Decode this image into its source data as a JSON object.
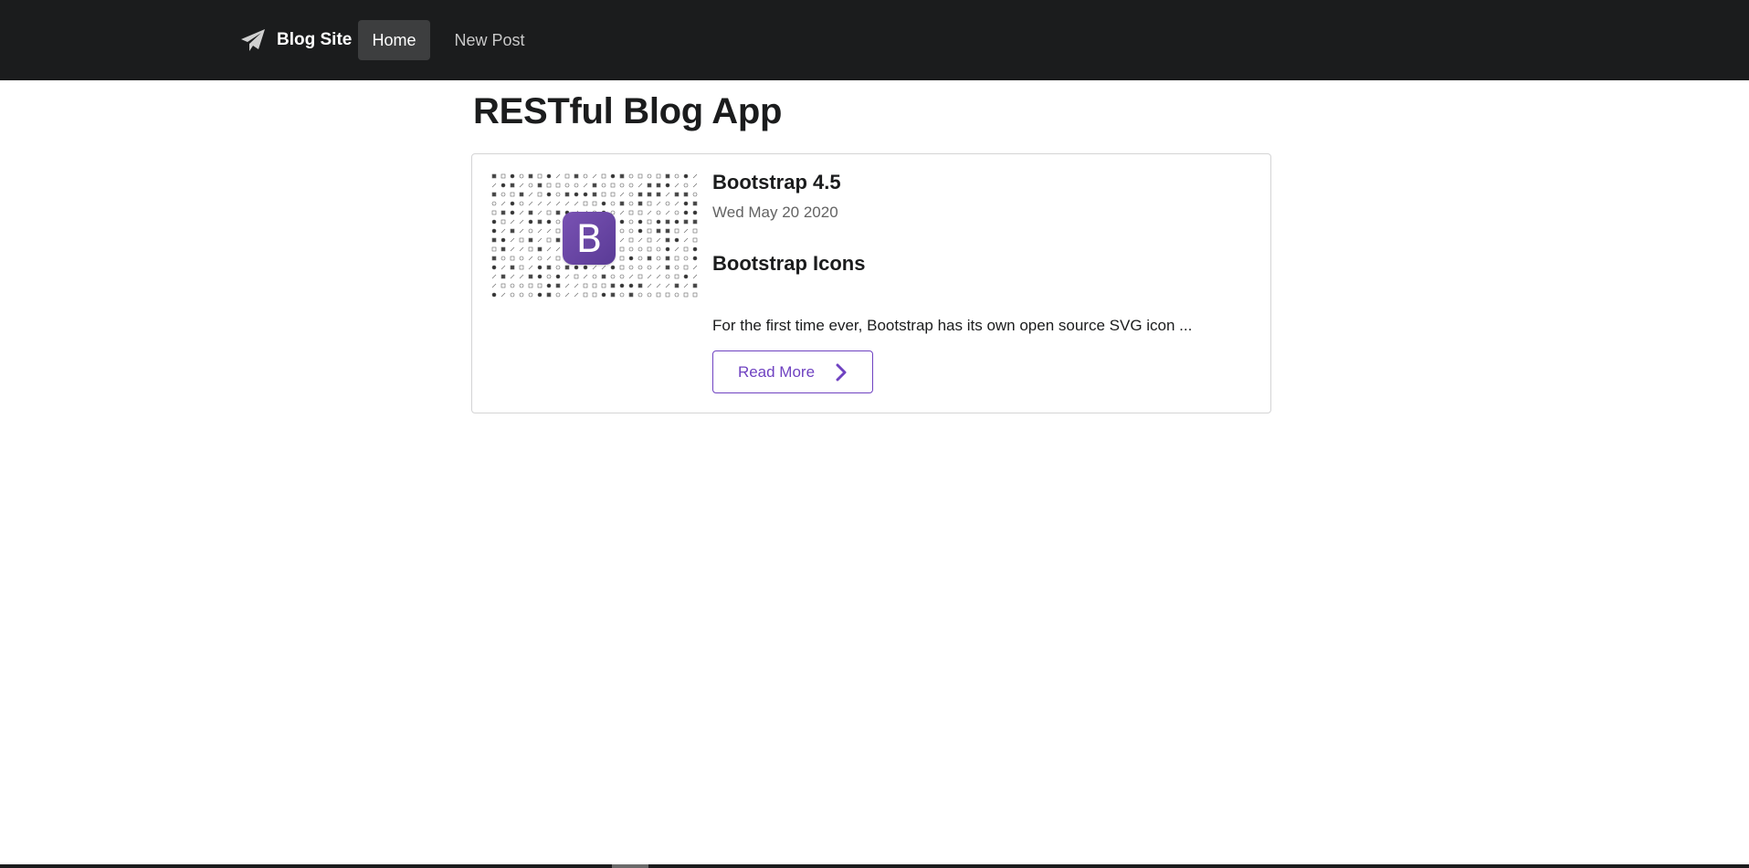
{
  "navbar": {
    "brand_label": "Blog Site",
    "brand_icon": "paper-plane-icon",
    "items": [
      {
        "label": "Home",
        "active": true
      },
      {
        "label": "New Post",
        "active": false
      }
    ]
  },
  "page": {
    "title": "RESTful Blog App"
  },
  "posts": [
    {
      "title": "Bootstrap 4.5",
      "date": "Wed May 20 2020",
      "heading": "Bootstrap Icons",
      "excerpt": "For the first time ever, Bootstrap has its own open source SVG icon ...",
      "image_logo_letter": "B",
      "read_more_label": "Read More",
      "read_more_icon": "chevron-right-icon"
    }
  ],
  "colors": {
    "navbar_bg": "#1b1c1d",
    "active_item_bg": "#3d3e3f",
    "accent": "#6f42c1"
  }
}
